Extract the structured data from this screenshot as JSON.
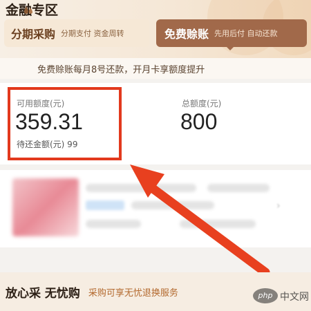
{
  "section_title": "金融专区",
  "tabs": [
    {
      "label": "分期采购",
      "sub": "分期支付  资金周转",
      "active": false
    },
    {
      "label": "免费赊账",
      "sub": "先用后付  自动还款",
      "active": true
    }
  ],
  "notice": {
    "icon": "coin-drop-icon",
    "text": "免费赊账每月8号还款，开月卡享额度提升"
  },
  "credit": {
    "available_label": "可用额度(元)",
    "available_value": "359.31",
    "pending_label": "待还金额(元) 99",
    "total_label": "总额度(元)",
    "total_value": "800"
  },
  "bottom": {
    "title": "放心采 无忧购",
    "subtitle": "采购可享无忧退换服务"
  },
  "watermark": {
    "logo_text": "php",
    "site_text": "中文网"
  },
  "colors": {
    "accent_brown": "#a1694a",
    "highlight_red": "#e2391d",
    "arrow_red": "#e8401f",
    "bottom_sub": "#b3692e"
  }
}
